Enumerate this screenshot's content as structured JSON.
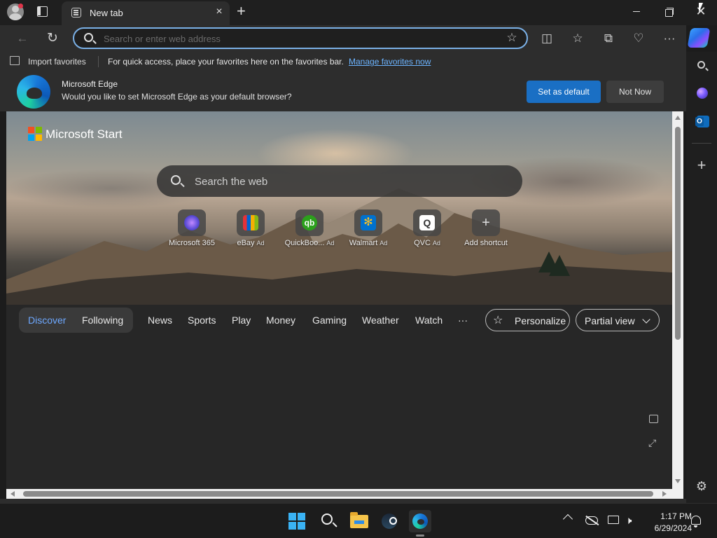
{
  "tab": {
    "title": "New tab",
    "close_glyph": "×",
    "new_tab_glyph": "+"
  },
  "window_controls": {
    "close_glyph": "✕"
  },
  "toolbar": {
    "back_glyph": "←",
    "refresh_glyph": "↻",
    "address_placeholder": "Search or enter web address",
    "favorite_glyph": "☆",
    "split_screen_glyph": "◫",
    "favorites_glyph": "☆",
    "collections_glyph": "⧉",
    "browser_essentials_glyph": "♡",
    "more_glyph": "···"
  },
  "favorites_bar": {
    "import_label": "Import favorites",
    "message": "For quick access, place your favorites here on the favorites bar.",
    "manage_link": "Manage favorites now"
  },
  "banner": {
    "title": "Microsoft Edge",
    "question": "Would you like to set Microsoft Edge as your default browser?",
    "set_default_label": "Set as default",
    "not_now_label": "Not Now"
  },
  "new_tab_page": {
    "brand_label": "Microsoft Start",
    "search_placeholder": "Search the web",
    "shortcuts": [
      {
        "label": "Microsoft 365",
        "ad": "",
        "glyph": "",
        "color": "#5b4bd6"
      },
      {
        "label": "eBay",
        "ad": "Ad",
        "glyph": "",
        "color": "#e53238"
      },
      {
        "label": "QuickBoo...",
        "ad": "Ad",
        "glyph": "qb",
        "color": "#2ca01c"
      },
      {
        "label": "Walmart",
        "ad": "Ad",
        "glyph": "✻",
        "color": "#0071ce"
      },
      {
        "label": "QVC",
        "ad": "Ad",
        "glyph": "Q",
        "color": "#ffffff"
      },
      {
        "label": "Add shortcut",
        "ad": "",
        "glyph": "+",
        "color": ""
      }
    ],
    "feed_tabs": {
      "discover": "Discover",
      "following": "Following",
      "news": "News",
      "sports": "Sports",
      "play": "Play",
      "money": "Money",
      "gaming": "Gaming",
      "weather": "Weather",
      "watch": "Watch",
      "more": "···"
    },
    "personalize_label": "Personalize",
    "personalize_glyph": "☆",
    "view_label": "Partial view",
    "expand_glyph": "⤢"
  },
  "sidebar": {
    "add_glyph": "+",
    "settings_glyph": "⚙"
  },
  "taskbar": {
    "volume_glyph": "🕨",
    "clock_time": "1:17 PM",
    "clock_date": "6/29/2024"
  },
  "colors": {
    "accent": "#1a6fc4",
    "link": "#6cb4ff",
    "discover_active": "#6ea8ff",
    "ms_logo": [
      "#f25022",
      "#7fba00",
      "#00a4ef",
      "#ffb900"
    ],
    "start_tiles": "#3ab3f5"
  }
}
